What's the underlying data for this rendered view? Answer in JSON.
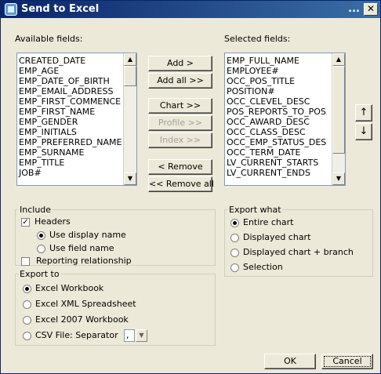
{
  "window": {
    "title": "Send to Excel",
    "title_dots": "...",
    "close_glyph": "✕"
  },
  "available": {
    "label": "Available fields:",
    "items": [
      "CREATED_DATE",
      "EMP_AGE",
      "EMP_DATE_OF_BIRTH",
      "EMP_EMAIL_ADDRESS",
      "EMP_FIRST_COMMENCE",
      "EMP_FIRST_NAME",
      "EMP_GENDER",
      "EMP_INITIALS",
      "EMP_PREFERRED_NAME",
      "EMP_SURNAME",
      "EMP_TITLE",
      "JOB#"
    ]
  },
  "selected": {
    "label": "Selected fields:",
    "items": [
      "EMP_FULL_NAME",
      "EMPLOYEE#",
      "OCC_POS_TITLE",
      "POSITION#",
      "OCC_CLEVEL_DESC",
      "POS_REPORTS_TO_POS",
      "OCC_AWARD_DESC",
      "OCC_CLASS_DESC",
      "OCC_EMP_STATUS_DES",
      "OCC_TERM_DATE",
      "LV_CURRENT_STARTS",
      "LV_CURRENT_ENDS"
    ]
  },
  "buttons": {
    "add": "Add >",
    "add_all": "Add all >>",
    "chart": "Chart >>",
    "profile": "Profile >>",
    "index": "Index >>",
    "remove": "< Remove",
    "remove_all": "<< Remove all",
    "move_up": "↑",
    "move_down": "↓",
    "ok": "OK",
    "cancel": "Cancel"
  },
  "scroll_glyphs": {
    "up": "▲",
    "down": "▼"
  },
  "include": {
    "legend": "Include",
    "headers": {
      "label": "Headers",
      "checked": true,
      "check_glyph": "✓"
    },
    "use_display_name": {
      "label": "Use display name",
      "selected": true
    },
    "use_field_name": {
      "label": "Use field name",
      "selected": false
    },
    "reporting_relationship": {
      "label": "Reporting relationship",
      "checked": false
    }
  },
  "export_what": {
    "legend": "Export what",
    "options": [
      {
        "label": "Entire chart",
        "selected": true
      },
      {
        "label": "Displayed chart",
        "selected": false
      },
      {
        "label": "Displayed chart + branch",
        "selected": false
      },
      {
        "label": "Selection",
        "selected": false
      }
    ]
  },
  "export_to": {
    "legend": "Export to",
    "options": [
      {
        "label": "Excel Workbook",
        "selected": true
      },
      {
        "label": "Excel XML Spreadsheet",
        "selected": false
      },
      {
        "label": "Excel 2007 Workbook",
        "selected": false
      },
      {
        "label": "CSV File: Separator",
        "selected": false
      }
    ],
    "separator_value": ",",
    "separator_dropdown_glyph": "▼"
  }
}
